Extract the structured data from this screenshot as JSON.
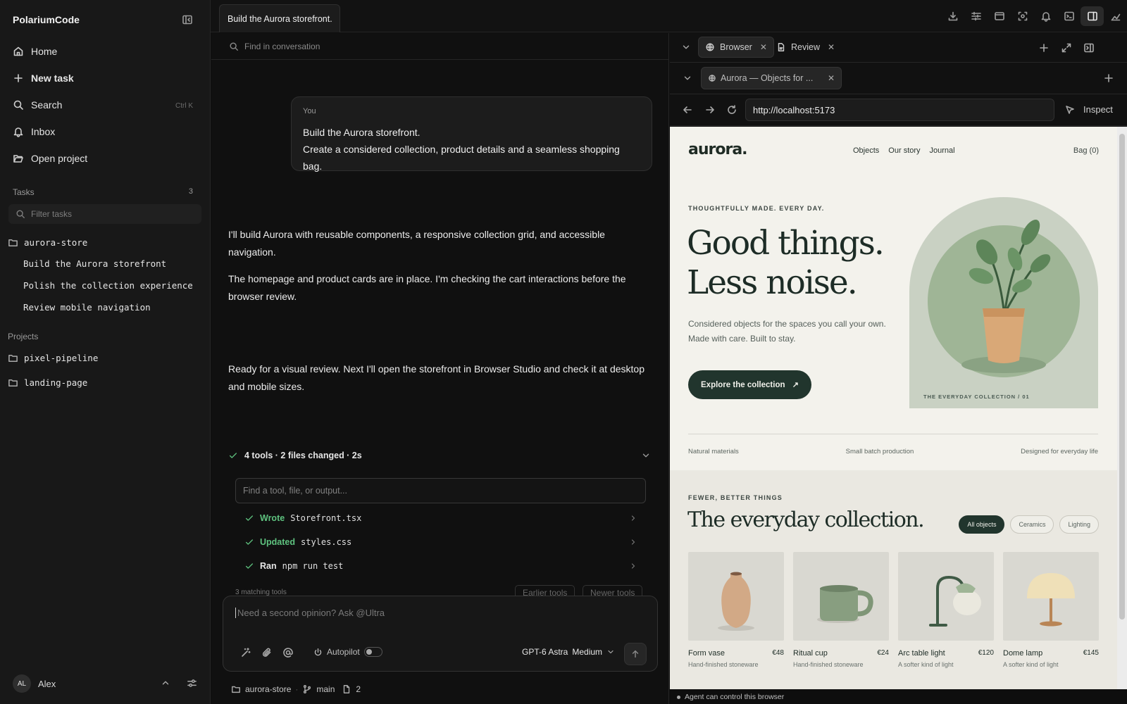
{
  "app": {
    "title": "PolariumCode"
  },
  "sidebar": {
    "nav": [
      {
        "label": "Home",
        "icon": "home-icon"
      },
      {
        "label": "New task",
        "icon": "plus-icon"
      },
      {
        "label": "Search",
        "icon": "search-icon",
        "shortcut": "Ctrl K"
      },
      {
        "label": "Inbox",
        "icon": "bell-icon"
      },
      {
        "label": "Open project",
        "icon": "folder-open-icon"
      }
    ],
    "tasks_label": "Tasks",
    "tasks_count": "3",
    "filter_placeholder": "Filter tasks",
    "project": "aurora-store",
    "tasks": [
      "Build the Aurora storefront",
      "Polish the collection experience",
      "Review mobile navigation"
    ],
    "projects_label": "Projects",
    "projects": [
      "pixel-pipeline",
      "landing-page"
    ],
    "user": {
      "initials": "AL",
      "name": "Alex"
    }
  },
  "conversation": {
    "tab_title": "Build the Aurora storefront.",
    "find_placeholder": "Find in conversation",
    "user_label": "You",
    "user_message": [
      "Build the Aurora storefront.",
      "Create a considered collection, product details and a seamless shopping bag."
    ],
    "assistant_messages": [
      "I'll build Aurora with reusable components, a responsive collection grid, and accessible navigation.",
      "The homepage and product cards are in place. I'm checking the cart interactions before the browser review.",
      "Ready for a visual review. Next I'll open the storefront in Browser Studio and check it at desktop and mobile sizes."
    ],
    "tools_summary": "4 tools · 2 files changed · 2s",
    "tool_find_placeholder": "Find a tool, file, or output...",
    "tools": [
      {
        "verb": "Wrote",
        "target": "Storefront.tsx"
      },
      {
        "verb": "Updated",
        "target": "styles.css"
      },
      {
        "verb": "Ran",
        "target": "npm run test"
      }
    ],
    "matching_label": "3 matching tools",
    "earlier_label": "Earlier tools",
    "newer_label": "Newer tools"
  },
  "composer": {
    "placeholder": "Need a second opinion? Ask @Ultra",
    "autopilot_label": "Autopilot",
    "model": "GPT-6 Astra",
    "effort": "Medium"
  },
  "footer": {
    "project": "aurora-store",
    "branch": "main",
    "files": "2"
  },
  "browser": {
    "panel_tabs": [
      {
        "label": "Browser",
        "icon": "globe-icon"
      },
      {
        "label": "Review",
        "icon": "document-icon"
      }
    ],
    "page_tab": "Aurora — Objects for ...",
    "url": "http://localhost:5173",
    "inspect_label": "Inspect",
    "status": "Agent can control this browser"
  },
  "site": {
    "logo": "aurora.",
    "nav": [
      "Objects",
      "Our story",
      "Journal"
    ],
    "bag": "Bag (0)",
    "eyebrow": "THOUGHTFULLY MADE. EVERY DAY.",
    "headline": [
      "Good things.",
      "Less noise."
    ],
    "subtext": [
      "Considered objects for the spaces you call your own.",
      "Made with care. Built to stay."
    ],
    "cta": "Explore the collection",
    "cta_arrow": "↗",
    "hero_caption": "THE EVERYDAY COLLECTION / 01",
    "features": [
      "Natural materials",
      "Small batch production",
      "Designed for everyday life"
    ],
    "collection_eyebrow": "FEWER, BETTER THINGS",
    "collection_title": "The everyday collection.",
    "filters": [
      "All objects",
      "Ceramics",
      "Lighting"
    ],
    "products": [
      {
        "name": "Form vase",
        "price": "€48",
        "desc": "Hand-finished stoneware"
      },
      {
        "name": "Ritual cup",
        "price": "€24",
        "desc": "Hand-finished stoneware"
      },
      {
        "name": "Arc table light",
        "price": "€120",
        "desc": "A softer kind of light"
      },
      {
        "name": "Dome lamp",
        "price": "€145",
        "desc": "A softer kind of light"
      }
    ]
  },
  "colors": {
    "accent_green": "#5ec27f",
    "brand_dark_green": "#21352d",
    "site_bg": "#f3f2ec"
  }
}
